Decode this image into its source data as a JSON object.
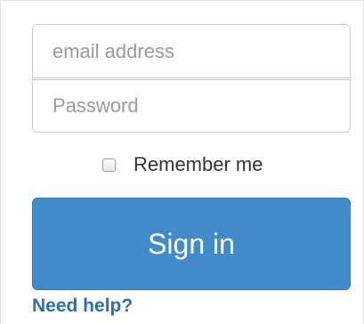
{
  "login": {
    "email_placeholder": "email address",
    "password_placeholder": "Password",
    "remember_label": "Remember me",
    "remember_checked": false,
    "signin_label": "Sign in",
    "help_link": "Need help?"
  },
  "colors": {
    "primary_button": "#428bca",
    "link": "#2a6fb7",
    "border": "#cccccc"
  }
}
